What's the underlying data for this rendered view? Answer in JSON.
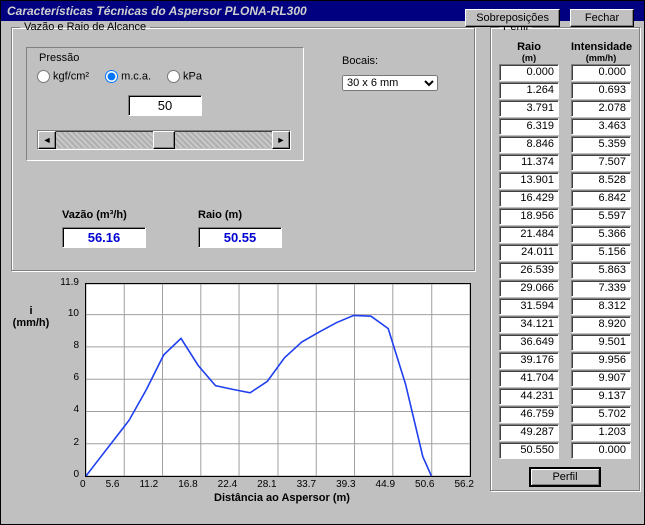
{
  "window": {
    "title": "Características Técnicas do Aspersor PLONA-RL300"
  },
  "flow_group": {
    "legend": "Vazão e Raio de Alcance",
    "pressure": {
      "label": "Pressão",
      "options": [
        "kgf/cm²",
        "m.c.a.",
        "kPa"
      ],
      "selected_index": 1,
      "value": "50"
    },
    "bocais": {
      "label": "Bocais:",
      "selected": "30 x 6 mm"
    },
    "vazao": {
      "label": "Vazão (m³/h)",
      "value": "56.16"
    },
    "raio": {
      "label": "Raio (m)",
      "value": "50.55"
    }
  },
  "perfil": {
    "legend": "Perfil",
    "col1_header": "Raio",
    "col1_unit": "(m)",
    "col2_header": "Intensidade",
    "col2_unit": "(mm/h)",
    "rows": [
      {
        "raio": "0.000",
        "int": "0.000"
      },
      {
        "raio": "1.264",
        "int": "0.693"
      },
      {
        "raio": "3.791",
        "int": "2.078"
      },
      {
        "raio": "6.319",
        "int": "3.463"
      },
      {
        "raio": "8.846",
        "int": "5.359"
      },
      {
        "raio": "11.374",
        "int": "7.507"
      },
      {
        "raio": "13.901",
        "int": "8.528"
      },
      {
        "raio": "16.429",
        "int": "6.842"
      },
      {
        "raio": "18.956",
        "int": "5.597"
      },
      {
        "raio": "21.484",
        "int": "5.366"
      },
      {
        "raio": "24.011",
        "int": "5.156"
      },
      {
        "raio": "26.539",
        "int": "5.863"
      },
      {
        "raio": "29.066",
        "int": "7.339"
      },
      {
        "raio": "31.594",
        "int": "8.312"
      },
      {
        "raio": "34.121",
        "int": "8.920"
      },
      {
        "raio": "36.649",
        "int": "9.501"
      },
      {
        "raio": "39.176",
        "int": "9.956"
      },
      {
        "raio": "41.704",
        "int": "9.907"
      },
      {
        "raio": "44.231",
        "int": "9.137"
      },
      {
        "raio": "46.759",
        "int": "5.702"
      },
      {
        "raio": "49.287",
        "int": "1.203"
      },
      {
        "raio": "50.550",
        "int": "0.000"
      }
    ],
    "button": "Perfil"
  },
  "buttons": {
    "sobreposicoes": "Sobreposições",
    "fechar": "Fechar"
  },
  "chart_data": {
    "type": "line",
    "title": "",
    "xlabel": "Distância ao Aspersor (m)",
    "ylabel_line1": "i",
    "ylabel_line2": "(mm/h)",
    "x_ticks": [
      0,
      5.6,
      11.2,
      16.8,
      22.4,
      28.1,
      33.7,
      39.3,
      44.9,
      50.6,
      56.2
    ],
    "y_ticks": [
      0,
      2.0,
      4.0,
      6.0,
      8.0,
      10.0,
      11.9
    ],
    "xlim": [
      0,
      56.2
    ],
    "ylim": [
      0,
      11.9
    ],
    "series": [
      {
        "name": "i",
        "x": [
          0.0,
          1.264,
          3.791,
          6.319,
          8.846,
          11.374,
          13.901,
          16.429,
          18.956,
          21.484,
          24.011,
          26.539,
          29.066,
          31.594,
          34.121,
          36.649,
          39.176,
          41.704,
          44.231,
          46.759,
          49.287,
          50.55
        ],
        "y": [
          0.0,
          0.693,
          2.078,
          3.463,
          5.359,
          7.507,
          8.528,
          6.842,
          5.597,
          5.366,
          5.156,
          5.863,
          7.339,
          8.312,
          8.92,
          9.501,
          9.956,
          9.907,
          9.137,
          5.702,
          1.203,
          0.0
        ]
      }
    ],
    "line_color": "#2040f0"
  }
}
